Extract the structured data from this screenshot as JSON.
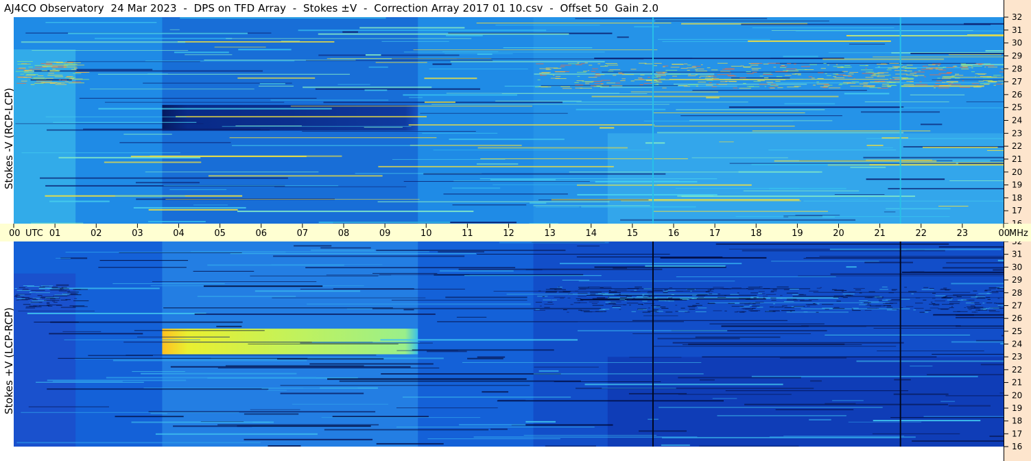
{
  "title": "AJ4CO Observatory  24 Mar 2023  -  DPS on TFD Array  -  Stokes ±V  -  Correction Array 2017 01 10.csv  -  Offset 50  Gain 2.0",
  "chart_data": {
    "type": "heatmap",
    "panels": [
      {
        "ylabel": "Stokes -V (RCP-LCP)",
        "polarity": "minus",
        "colorscale": "jet-like (dark blue to red)"
      },
      {
        "ylabel": "Stokes +V (LCP-RCP)",
        "polarity": "plus",
        "colorscale": "jet-like (dark blue to red)"
      }
    ],
    "x_axis": {
      "unit_label": "UTC",
      "range_hours": [
        0,
        24
      ],
      "ticks": [
        "00",
        "01",
        "02",
        "03",
        "04",
        "05",
        "06",
        "07",
        "08",
        "09",
        "10",
        "11",
        "12",
        "13",
        "14",
        "15",
        "16",
        "17",
        "18",
        "19",
        "20",
        "21",
        "22",
        "23",
        "00"
      ]
    },
    "y_axis": {
      "unit_label": "MHz",
      "range_mhz": [
        16,
        32
      ],
      "ticks": [
        "32",
        "31",
        "30",
        "29",
        "28",
        "27",
        "26",
        "25",
        "24",
        "23",
        "22",
        "21",
        "20",
        "19",
        "18",
        "17",
        "16"
      ]
    },
    "features": [
      {
        "description": "strong band",
        "time_start_h": 3.6,
        "time_end_h": 9.8,
        "freq_low_mhz": 23.2,
        "freq_high_mhz": 25.2,
        "peak_time_h": 4.0
      },
      {
        "description": "bursty interference",
        "time_start_h": 12.6,
        "time_end_h": 24,
        "freq_low_mhz": 26.5,
        "freq_high_mhz": 28.5
      },
      {
        "description": "vertical line",
        "time_h": 15.5
      },
      {
        "description": "vertical line",
        "time_h": 21.5
      }
    ]
  }
}
